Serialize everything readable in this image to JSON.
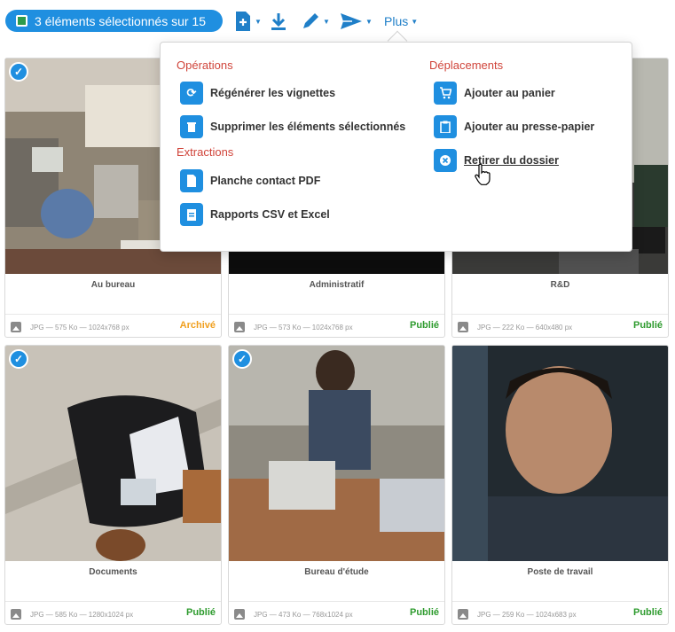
{
  "toolbar": {
    "selection_label": "3 éléments sélectionnés sur 15",
    "more_label": "Plus",
    "icons": [
      "add-file-icon",
      "download-icon",
      "edit-pencil-icon",
      "send-icon"
    ]
  },
  "menu": {
    "sections": {
      "operations": "Opérations",
      "extractions": "Extractions",
      "deplacements": "Déplacements"
    },
    "items": {
      "regen": "Régénérer les vignettes",
      "delete": "Supprimer les éléments sélectionnés",
      "pdf": "Planche contact PDF",
      "csv": "Rapports CSV et Excel",
      "cart": "Ajouter au panier",
      "clipboard": "Ajouter au presse-papier",
      "remove": "Retirer du dossier"
    }
  },
  "cards": [
    {
      "title": "Au bureau",
      "meta": "JPG — 575 Ko — 1024x768 px",
      "status": "Archivé",
      "status_color": "#f0a020",
      "selected": true
    },
    {
      "title": "Administratif",
      "meta": "JPG — 573 Ko — 1024x768 px",
      "status": "Publié",
      "status_color": "#2e9b2e",
      "selected": false
    },
    {
      "title": "R&D",
      "meta": "JPG — 222 Ko — 640x480 px",
      "status": "Publié",
      "status_color": "#2e9b2e",
      "selected": false
    },
    {
      "title": "Documents",
      "meta": "JPG — 585 Ko — 1280x1024 px",
      "status": "Publié",
      "status_color": "#2e9b2e",
      "selected": true
    },
    {
      "title": "Bureau d'étude",
      "meta": "JPG — 473 Ko — 768x1024 px",
      "status": "Publié",
      "status_color": "#2e9b2e",
      "selected": true
    },
    {
      "title": "Poste de travail",
      "meta": "JPG — 259 Ko — 1024x683 px",
      "status": "Publié",
      "status_color": "#2e9b2e",
      "selected": false
    }
  ],
  "colors": {
    "accent": "#1f8fe0",
    "section_title": "#d0443a",
    "published": "#2e9b2e",
    "archived": "#f0a020"
  }
}
